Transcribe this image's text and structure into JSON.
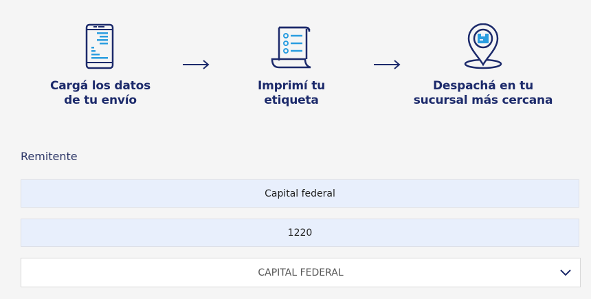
{
  "steps": [
    {
      "icon": "phone-form-icon",
      "label_line1": "Cargá los datos",
      "label_line2": "de tu envío"
    },
    {
      "icon": "receipt-checklist-icon",
      "label_line1": "Imprimí tu",
      "label_line2": "etiqueta"
    },
    {
      "icon": "location-pin-package-icon",
      "label_line1": "Despachá en tu",
      "label_line2": "sucursal más cercana"
    }
  ],
  "form": {
    "section_label": "Remitente",
    "province_field_value": "Capital federal",
    "postal_code_field_value": "1220",
    "city_select_value": "CAPITAL FEDERAL"
  },
  "colors": {
    "brand_navy": "#1c2a6b",
    "accent_blue": "#2a9de0",
    "field_background": "#e8effc"
  }
}
